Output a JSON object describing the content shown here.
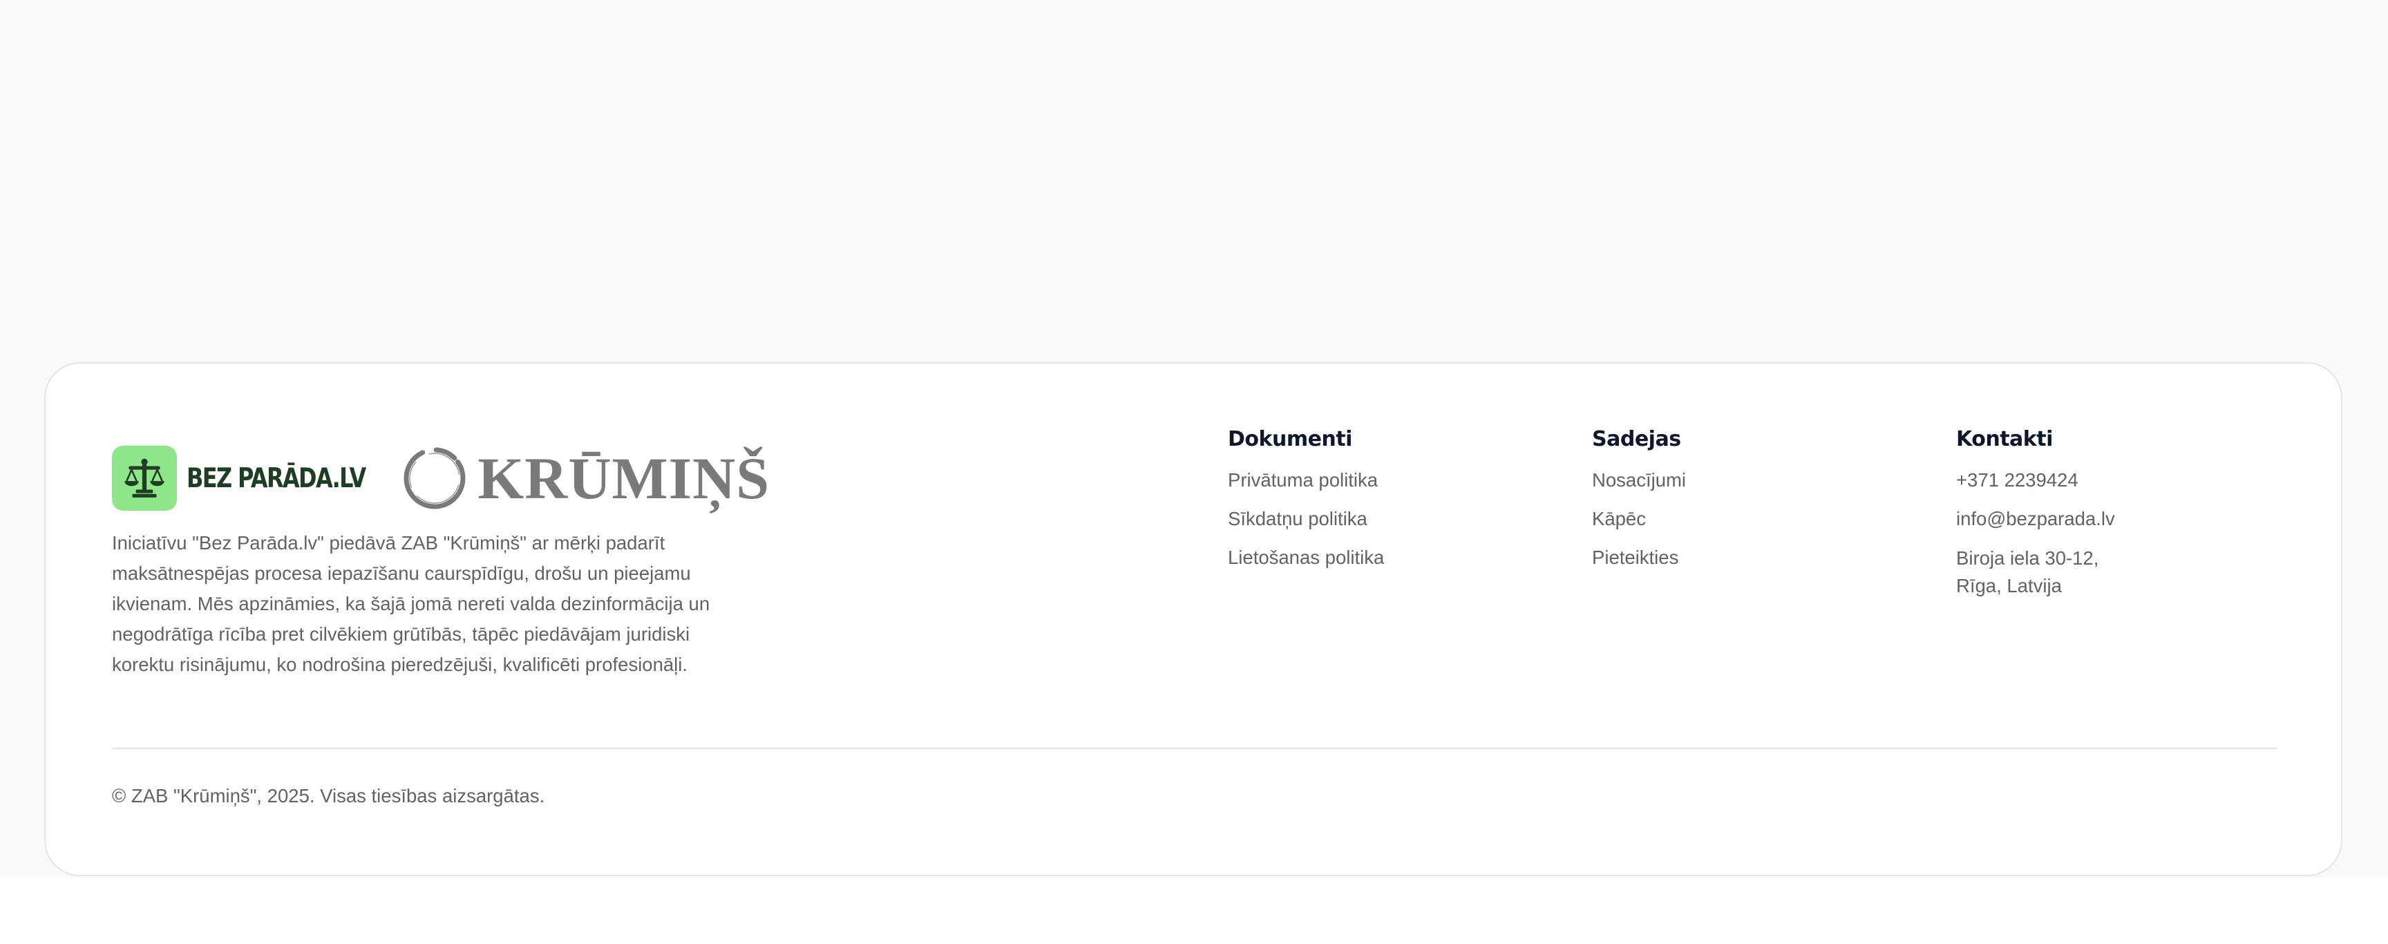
{
  "footer": {
    "logos": {
      "bezparada_label": "BEZ PARĀDA.LV",
      "krumins_label": "KRŪMIŅŠ",
      "bezparada_badge_color": "#8ee58a",
      "bezparada_text_color": "#1f3d22",
      "krumins_color": "#7a7a7a"
    },
    "about_text": "Iniciatīvu \"Bez Parāda.lv\" piedāvā ZAB \"Krūmiņš\" ar mērķi padarīt maksātnespējas procesa iepazīšanu caurspīdīgu, drošu un pieejamu ikvienam. Mēs apzināmies, ka šajā jomā nereti valda dezinformācija un negodrātīga rīcība pret cilvēkiem grūtībās, tāpēc piedāvājam juridiski korektu risinājumu, ko nodrošina pieredzējuši, kvalificēti profesionāļi.",
    "columns": {
      "dokumenti": {
        "title": "Dokumenti",
        "links": [
          "Privātuma politika",
          "Sīkdatņu politika",
          "Lietošanas politika"
        ]
      },
      "sadejas": {
        "title": "Sadejas",
        "links": [
          "Nosacījumi",
          "Kāpēc",
          "Pieteikties"
        ]
      },
      "kontakti": {
        "title": "Kontakti",
        "phone": "+371 2239424",
        "email": "info@bezparada.lv",
        "address_line1": "Biroja iela 30-12,",
        "address_line2": "Rīga, Latvija"
      }
    },
    "copyright": "© ZAB \"Krūmiņš\", 2025. Visas tiesības aizsargātas."
  }
}
